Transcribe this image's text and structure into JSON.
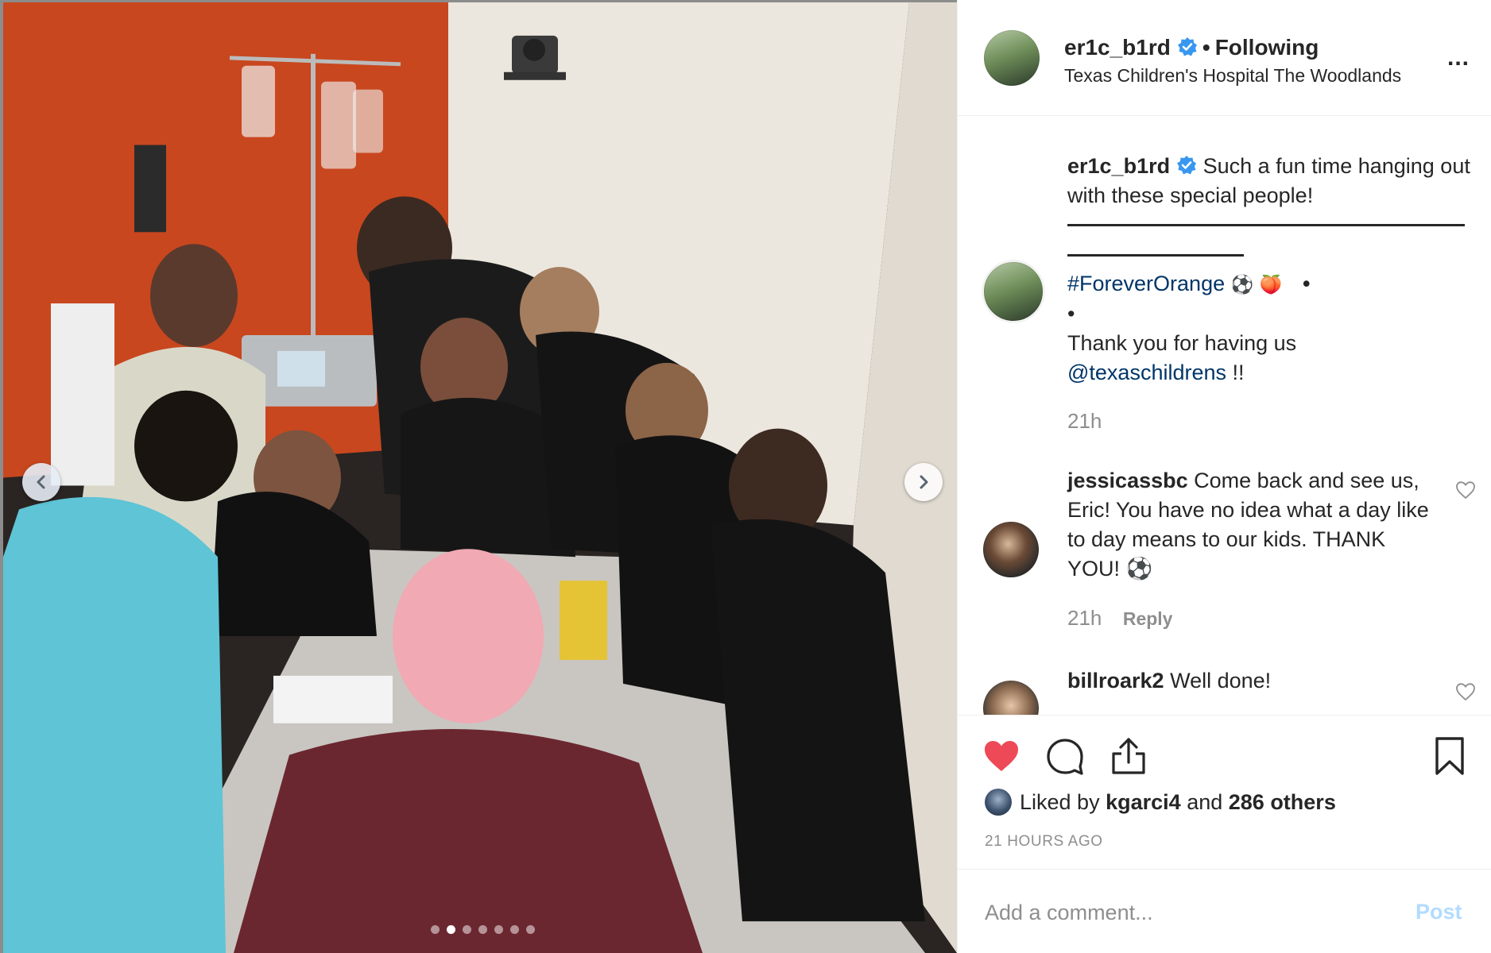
{
  "post": {
    "photo_alt": "Houston Dynamo players coloring with kids at a hospital table",
    "carousel": {
      "count": 7,
      "active_index": 1
    }
  },
  "header": {
    "username": "er1c_b1rd",
    "separator": "•",
    "follow_status": "Following",
    "location": "Texas Children's Hospital The Woodlands",
    "more_label": "..."
  },
  "caption": {
    "username": "er1c_b1rd",
    "text": "Such a fun time hanging out with these special people!",
    "hashtag": "#ForeverOrange",
    "emoji_1": "⚽",
    "emoji_2": "🍑",
    "bullet_1": "•",
    "bullet_2": "•",
    "thanks_text": "Thank you for having us",
    "mention": "@texaschildrens",
    "mention_suffix": " !!",
    "time": "21h"
  },
  "comments": [
    {
      "username": "jessicassbc",
      "text": "Come back and see us, Eric! You have no idea what a day like to day means to our kids. THANK YOU! ⚽",
      "time": "21h",
      "reply_label": "Reply"
    },
    {
      "username": "billroark2",
      "text": "Well done!"
    }
  ],
  "actions": {
    "liked_by_prefix": "Liked by",
    "liked_by_user": "kgarci4",
    "liked_by_middle": "and",
    "liked_by_others": "286 others",
    "timestamp": "21 HOURS AGO"
  },
  "add_comment": {
    "placeholder": "Add a comment...",
    "post_label": "Post"
  },
  "colors": {
    "like_red": "#ed4956",
    "link_blue": "#003569",
    "verified_blue": "#3897f0",
    "post_disabled": "#b3dbff",
    "muted_gray": "#8e8e8e"
  },
  "icons": [
    "chevron-left-icon",
    "chevron-right-icon",
    "verified-badge-icon",
    "more-icon",
    "heart-icon",
    "comment-icon",
    "share-icon",
    "bookmark-icon"
  ]
}
